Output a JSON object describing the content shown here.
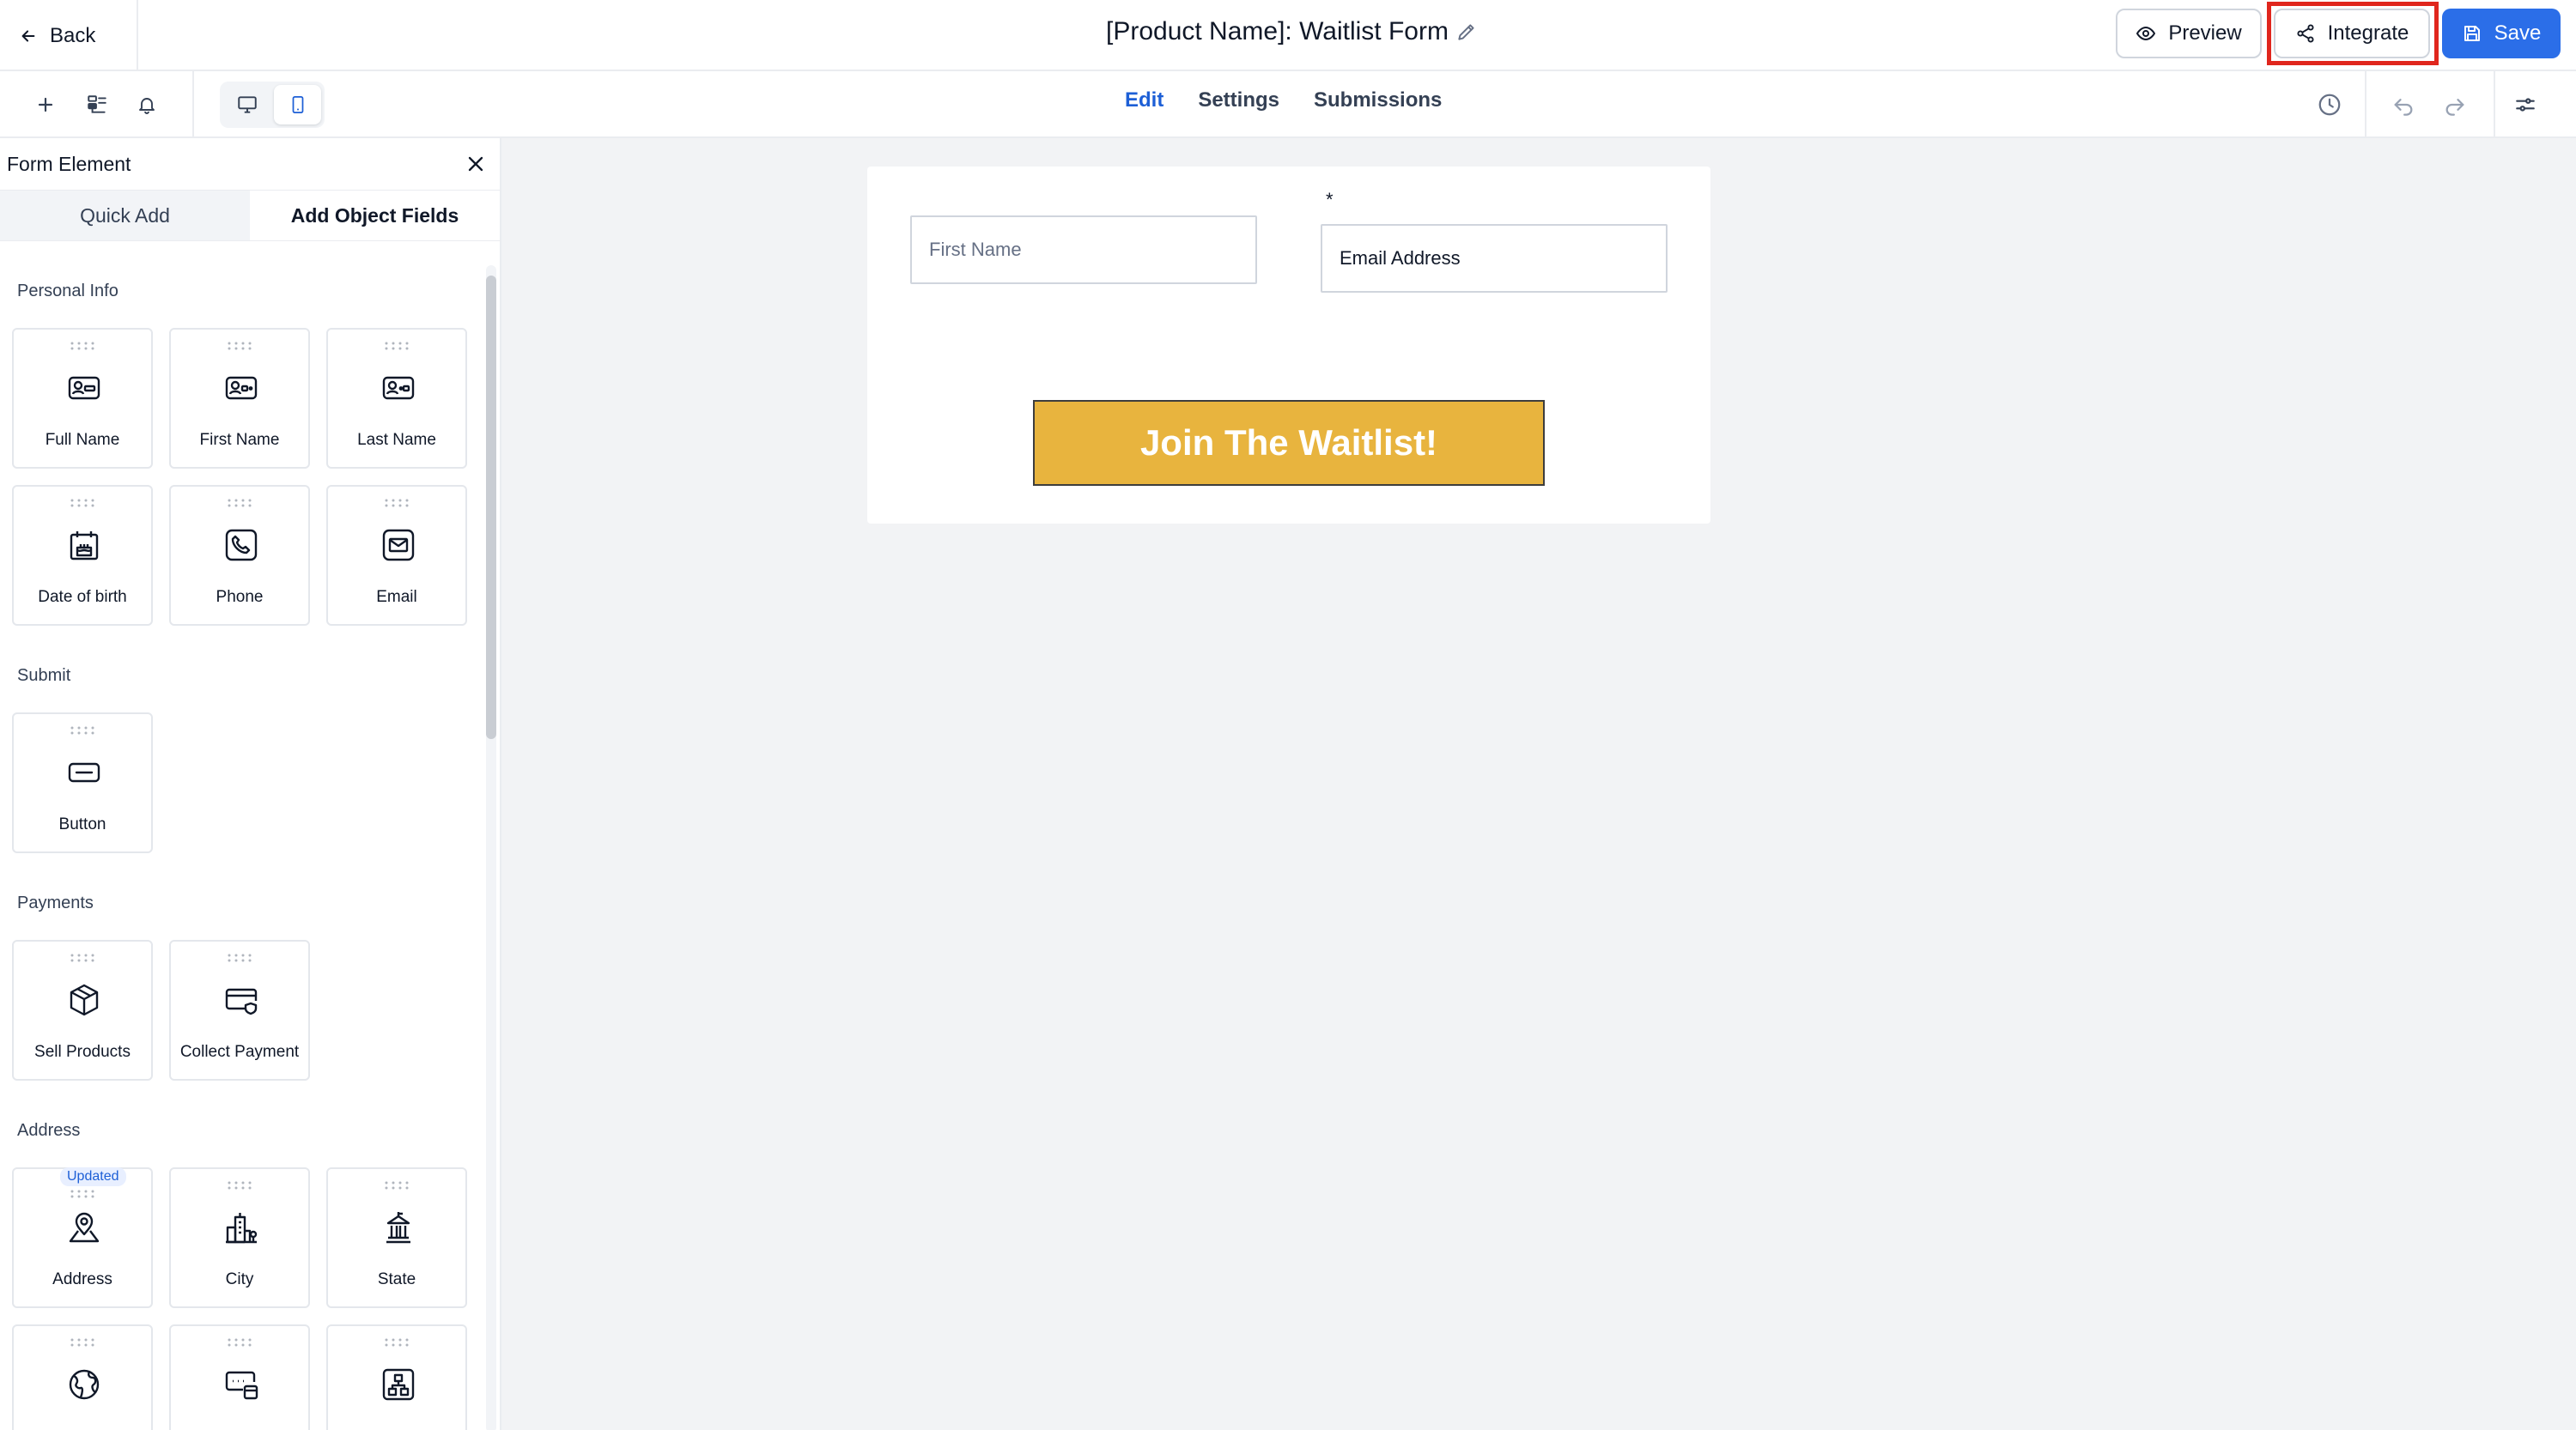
{
  "header": {
    "back_label": "Back",
    "title": "[Product Name]: Waitlist Form",
    "preview_label": "Preview",
    "integrate_label": "Integrate",
    "save_label": "Save"
  },
  "subbar": {
    "tabs": [
      {
        "label": "Edit",
        "active": true
      },
      {
        "label": "Settings",
        "active": false
      },
      {
        "label": "Submissions",
        "active": false
      }
    ]
  },
  "panel": {
    "title": "Form Element",
    "tabs": [
      "Quick Add",
      "Add Object Fields"
    ],
    "sections": [
      {
        "label": "Personal Info",
        "items": [
          "Full Name",
          "First Name",
          "Last Name",
          "Date of birth",
          "Phone",
          "Email"
        ]
      },
      {
        "label": "Submit",
        "items": [
          "Button"
        ]
      },
      {
        "label": "Payments",
        "items": [
          "Sell Products",
          "Collect Payment"
        ]
      },
      {
        "label": "Address",
        "items": [
          "Address",
          "City",
          "State"
        ],
        "badge": "Updated"
      }
    ]
  },
  "form": {
    "first_name_placeholder": "First Name",
    "email_value": "Email Address",
    "required_marker": "*",
    "cta_label": "Join The Waitlist!"
  },
  "colors": {
    "accent": "#2b6ee8",
    "highlight": "#e0261d",
    "cta_bg": "#e8b43e",
    "canvas_bg": "#f2f3f5"
  }
}
